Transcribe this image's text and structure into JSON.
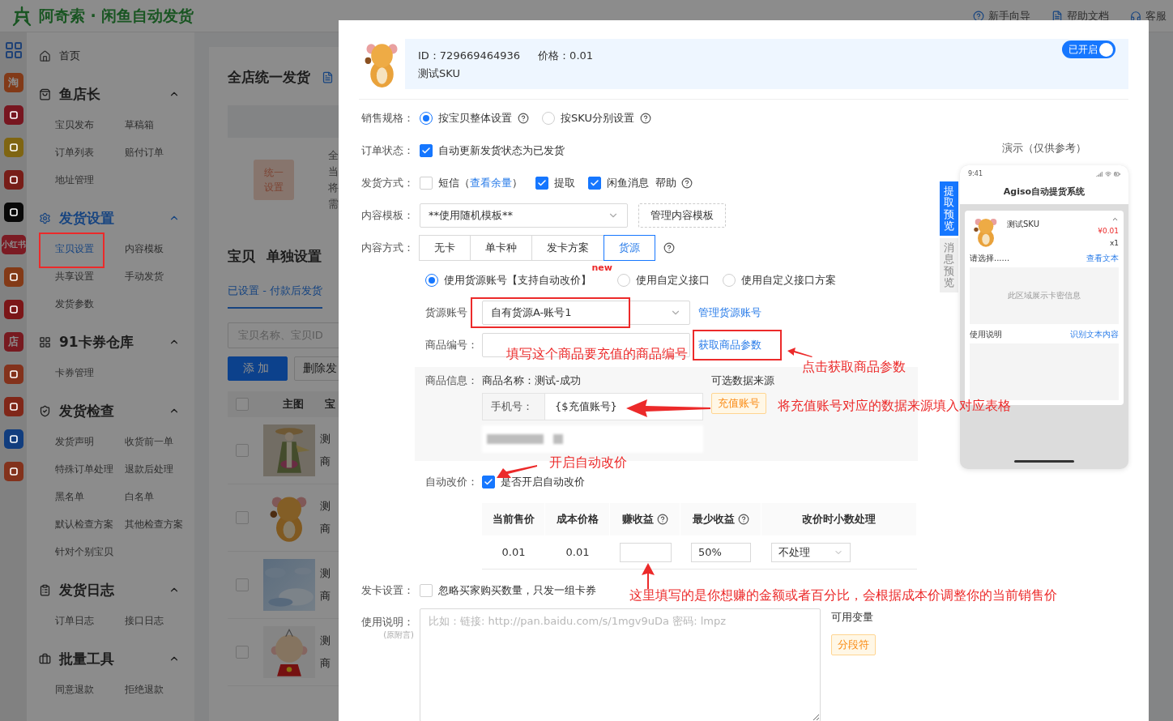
{
  "app": {
    "title": "阿奇索 · 闲鱼自动发货",
    "header_links": [
      "新手向导",
      "帮助文档",
      "客服"
    ]
  },
  "app_rail": [
    {
      "kind": "grid"
    },
    {
      "kind": "tile",
      "color": "#823a18",
      "glyph": "淘"
    },
    {
      "kind": "tile",
      "color": "#771620"
    },
    {
      "kind": "tile",
      "color": "#7f6512"
    },
    {
      "kind": "tile",
      "color": "#771d18"
    },
    {
      "kind": "tile",
      "color": "#090909"
    },
    {
      "kind": "tile",
      "color": "#7b1b23",
      "glyph": "小红书"
    },
    {
      "kind": "tile",
      "color": "#833a17"
    },
    {
      "kind": "tile",
      "color": "#7b1618"
    },
    {
      "kind": "tile",
      "color": "#771a20",
      "glyph": "店"
    },
    {
      "kind": "tile",
      "color": "#83321c"
    },
    {
      "kind": "tile",
      "color": "#802719"
    },
    {
      "kind": "tile",
      "color": "#113d7e"
    },
    {
      "kind": "tile",
      "color": "#83321c"
    }
  ],
  "sidebar": {
    "home": "首页",
    "groups": [
      {
        "title": "鱼店长",
        "active": false,
        "expanded": true,
        "items": [
          {
            "label": "宝贝发布",
            "selected": false
          },
          {
            "label": "草稿箱",
            "selected": false
          },
          {
            "label": "订单列表",
            "selected": false
          },
          {
            "label": "赔付订单",
            "selected": false
          },
          {
            "label": "地址管理",
            "selected": false
          }
        ]
      },
      {
        "title": "发货设置",
        "active": true,
        "expanded": true,
        "items": [
          {
            "label": "宝贝设置",
            "selected": true,
            "highlighted": true
          },
          {
            "label": "内容模板",
            "selected": false
          },
          {
            "label": "共享设置",
            "selected": false
          },
          {
            "label": "手动发货",
            "selected": false
          },
          {
            "label": "发货参数",
            "selected": false
          }
        ]
      },
      {
        "title": "91卡券仓库",
        "active": false,
        "expanded": true,
        "items": [
          {
            "label": "卡券管理",
            "selected": false
          }
        ]
      },
      {
        "title": "发货检查",
        "active": false,
        "expanded": true,
        "items": [
          {
            "label": "发货声明",
            "selected": false
          },
          {
            "label": "收货前一单",
            "selected": false
          },
          {
            "label": "特殊订单处理",
            "selected": false
          },
          {
            "label": "退款后处理",
            "selected": false
          },
          {
            "label": "黑名单",
            "selected": false
          },
          {
            "label": "白名单",
            "selected": false
          },
          {
            "label": "默认检查方案",
            "selected": false
          },
          {
            "label": "其他检查方案",
            "selected": false
          },
          {
            "label": "针对个别宝贝",
            "selected": false
          }
        ]
      },
      {
        "title": "发货日志",
        "active": false,
        "expanded": true,
        "items": [
          {
            "label": "订单日志",
            "selected": false
          },
          {
            "label": "接口日志",
            "selected": false
          }
        ]
      },
      {
        "title": "批量工具",
        "active": false,
        "expanded": true,
        "items": [
          {
            "label": "同意退款",
            "selected": false
          },
          {
            "label": "拒绝退款",
            "selected": false
          }
        ]
      }
    ]
  },
  "main": {
    "unified": {
      "title": "全店统一发货",
      "button": "统一设置",
      "desc_fragments": [
        "全",
        "当",
        "将",
        "需"
      ]
    },
    "single": {
      "title": "宝贝",
      "title2": "单独设置",
      "tab": "已设置 - 付款后发货",
      "search_placeholder": "宝贝名称、宝贝ID",
      "buttons": [
        {
          "label": "添加",
          "kind": "primary"
        },
        {
          "label": "删除发",
          "kind": "default"
        }
      ],
      "select_all": {
        "checked": false
      },
      "columns": [
        "主图",
        "宝"
      ],
      "rows": [
        {
          "checked": false,
          "name": "测",
          "sub": "商"
        },
        {
          "checked": false,
          "name": "测",
          "sub": "商"
        },
        {
          "checked": false,
          "name": "测",
          "sub": "商"
        },
        {
          "checked": false,
          "name": "测",
          "sub": "商"
        }
      ]
    }
  },
  "item_header": {
    "id_text": "ID：729669464936",
    "price_text": "价格：0.01",
    "sku": "测试SKU",
    "toggle": {
      "label": "已开启",
      "on": true
    }
  },
  "form": {
    "sale_spec": {
      "label": "销售规格：",
      "options": [
        {
          "label": "按宝贝整体设置",
          "selected": true,
          "help": true
        },
        {
          "label": "按SKU分别设置",
          "selected": false,
          "help": true
        }
      ]
    },
    "order_status": {
      "label": "订单状态：",
      "option": {
        "label": "自动更新发货状态为已发货",
        "checked": true
      }
    },
    "delivery": {
      "label": "发货方式：",
      "options": [
        {
          "label": "短信（",
          "link": "查看余量",
          "suffix": "）",
          "checked": false
        },
        {
          "label": "提取",
          "checked": true
        },
        {
          "label": "闲鱼消息",
          "checked": true
        }
      ],
      "help": "帮助"
    },
    "template": {
      "label": "内容模板：",
      "value": "**使用随机模板**",
      "button": "管理内容模板"
    },
    "content_mode": {
      "label": "内容方式：",
      "options": [
        {
          "label": "无卡",
          "selected": false
        },
        {
          "label": "单卡种",
          "selected": false
        },
        {
          "label": "发卡方案",
          "selected": false
        },
        {
          "label": "货源",
          "selected": true
        }
      ]
    },
    "source_mode": {
      "options": [
        {
          "label": "使用货源账号【支持自动改价】",
          "selected": true,
          "badge": "new"
        },
        {
          "label": "使用自定义接口",
          "selected": false
        },
        {
          "label": "使用自定义接口方案",
          "selected": false
        }
      ]
    },
    "source_account": {
      "label": "货源账号",
      "value": "自有货源A-账号1",
      "link": "管理货源账号",
      "highlighted": true
    },
    "product_no": {
      "label": "商品编号：",
      "link": "获取商品参数",
      "highlighted": true
    },
    "product_info": {
      "label": "商品信息：",
      "name": "商品名称：测试-成功",
      "sources_title": "可选数据来源",
      "params": [
        {
          "kind": "param",
          "label": "手机号：",
          "value": "{$充值账号}",
          "source": "充值账号"
        },
        {
          "kind": "redacted"
        }
      ]
    },
    "auto_price": {
      "label": "自动改价：",
      "option": {
        "label": "是否开启自动改价",
        "checked": true
      }
    },
    "price_table": {
      "columns": [
        {
          "label": "当前售价",
          "help": false
        },
        {
          "label": "成本价格",
          "help": false
        },
        {
          "label": "赚收益",
          "help": true
        },
        {
          "label": "最少收益",
          "help": true
        },
        {
          "label": "改价时小数处理",
          "help": false
        }
      ],
      "row": {
        "current": "0.01",
        "cost": "0.01",
        "min": "50%",
        "rounding": "不处理"
      }
    },
    "card_setting": {
      "label": "发卡设置：",
      "option": {
        "label": "忽略买家购买数量，只发一组卡券",
        "checked": false
      }
    },
    "instructions": {
      "label": "使用说明：",
      "sublabel": "(原附言)",
      "placeholder": "比如：链接: http://pan.baidu.com/s/1mgv9uDa 密码: lmpz",
      "vars_title": "可用变量",
      "vars": [
        "分段符"
      ]
    }
  },
  "preview": {
    "title": "演示（仅供参考）",
    "tabs": [
      {
        "label": "提取预览",
        "selected": true
      },
      {
        "label": "消息预览",
        "selected": false
      }
    ],
    "phone": {
      "time": "9:41",
      "app_title": "Agiso自动提货系统",
      "product": "测试SKU",
      "price": "¥0.01",
      "qty": "x1",
      "choose": "请选择......",
      "choose_link": "查看文本",
      "card_hint": "此区域展示卡密信息",
      "usage": "使用说明",
      "usage_link": "识别文本内容"
    }
  },
  "annotations": [
    {
      "text": "填写这个商品要充值的商品编号",
      "arrow": false
    },
    {
      "text": "点击获取商品参数",
      "arrow": true
    },
    {
      "text": "将充值账号对应的数据来源填入对应表格",
      "arrow": true
    },
    {
      "text": "开启自动改价",
      "arrow": true
    },
    {
      "text": "这里填写的是你想赚的金额或者百分比，会根据成本价调整你的当前销售价",
      "arrow": true
    }
  ]
}
